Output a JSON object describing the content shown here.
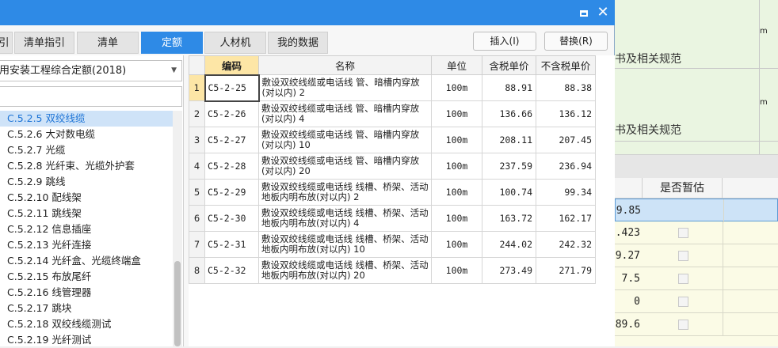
{
  "background": {
    "top_rows": [
      {
        "text": "书及相关规范",
        "unit": "m"
      },
      {
        "text": "书及相关规范",
        "unit": "m"
      }
    ],
    "grid_header": "是否暂估",
    "grid_values": [
      "9.85",
      ".423",
      "9.27",
      "7.5",
      "0",
      "89.6"
    ]
  },
  "dialog": {
    "tabs": [
      {
        "label": "引",
        "active": false
      },
      {
        "label": "清单指引",
        "active": false
      },
      {
        "label": "清单",
        "active": false
      },
      {
        "label": "定额",
        "active": true
      },
      {
        "label": "人材机",
        "active": false
      },
      {
        "label": "我的数据",
        "active": false
      }
    ],
    "insert_button": "插入(I)",
    "replace_button": "替换(R)",
    "library_select": "用安装工程综合定额(2018)",
    "search_placeholder": "",
    "tree_items": [
      {
        "label": "C.5.2.5 双绞线缆",
        "selected": true
      },
      {
        "label": "C.5.2.6 大对数电缆",
        "selected": false
      },
      {
        "label": "C.5.2.7 光缆",
        "selected": false
      },
      {
        "label": "C.5.2.8 光纤束、光缆外护套",
        "selected": false
      },
      {
        "label": "C.5.2.9 跳线",
        "selected": false
      },
      {
        "label": "C.5.2.10 配线架",
        "selected": false
      },
      {
        "label": "C.5.2.11 跳线架",
        "selected": false
      },
      {
        "label": "C.5.2.12 信息插座",
        "selected": false
      },
      {
        "label": "C.5.2.13 光纤连接",
        "selected": false
      },
      {
        "label": "C.5.2.14 光纤盒、光缆终端盒",
        "selected": false
      },
      {
        "label": "C.5.2.15 布放尾纤",
        "selected": false
      },
      {
        "label": "C.5.2.16 线管理器",
        "selected": false
      },
      {
        "label": "C.5.2.17 跳块",
        "selected": false
      },
      {
        "label": "C.5.2.18 双绞线缆测试",
        "selected": false
      },
      {
        "label": "C.5.2.19 光纤测试",
        "selected": false
      }
    ],
    "table": {
      "headers": [
        "",
        "编码",
        "名称",
        "单位",
        "含税单价",
        "不含税单价"
      ],
      "rows": [
        {
          "idx": "1",
          "code": "C5-2-25",
          "name": "敷设双绞线缆或电话线 管、暗槽内穿放(对以内) 2",
          "unit": "100m",
          "tax_price": "88.91",
          "notax_price": "88.38"
        },
        {
          "idx": "2",
          "code": "C5-2-26",
          "name": "敷设双绞线缆或电话线 管、暗槽内穿放(对以内) 4",
          "unit": "100m",
          "tax_price": "136.66",
          "notax_price": "136.12"
        },
        {
          "idx": "3",
          "code": "C5-2-27",
          "name": "敷设双绞线缆或电话线 管、暗槽内穿放(对以内) 10",
          "unit": "100m",
          "tax_price": "208.11",
          "notax_price": "207.45"
        },
        {
          "idx": "4",
          "code": "C5-2-28",
          "name": "敷设双绞线缆或电话线 管、暗槽内穿放(对以内) 20",
          "unit": "100m",
          "tax_price": "237.59",
          "notax_price": "236.94"
        },
        {
          "idx": "5",
          "code": "C5-2-29",
          "name": "敷设双绞线缆或电话线 线槽、桥架、活动地板内明布放(对以内) 2",
          "unit": "100m",
          "tax_price": "100.74",
          "notax_price": "99.34"
        },
        {
          "idx": "6",
          "code": "C5-2-30",
          "name": "敷设双绞线缆或电话线 线槽、桥架、活动地板内明布放(对以内) 4",
          "unit": "100m",
          "tax_price": "163.72",
          "notax_price": "162.17"
        },
        {
          "idx": "7",
          "code": "C5-2-31",
          "name": "敷设双绞线缆或电话线 线槽、桥架、活动地板内明布放(对以内) 10",
          "unit": "100m",
          "tax_price": "244.02",
          "notax_price": "242.32"
        },
        {
          "idx": "8",
          "code": "C5-2-32",
          "name": "敷设双绞线缆或电话线 线槽、桥架、活动地板内明布放(对以内) 20",
          "unit": "100m",
          "tax_price": "273.49",
          "notax_price": "271.79"
        }
      ]
    }
  }
}
